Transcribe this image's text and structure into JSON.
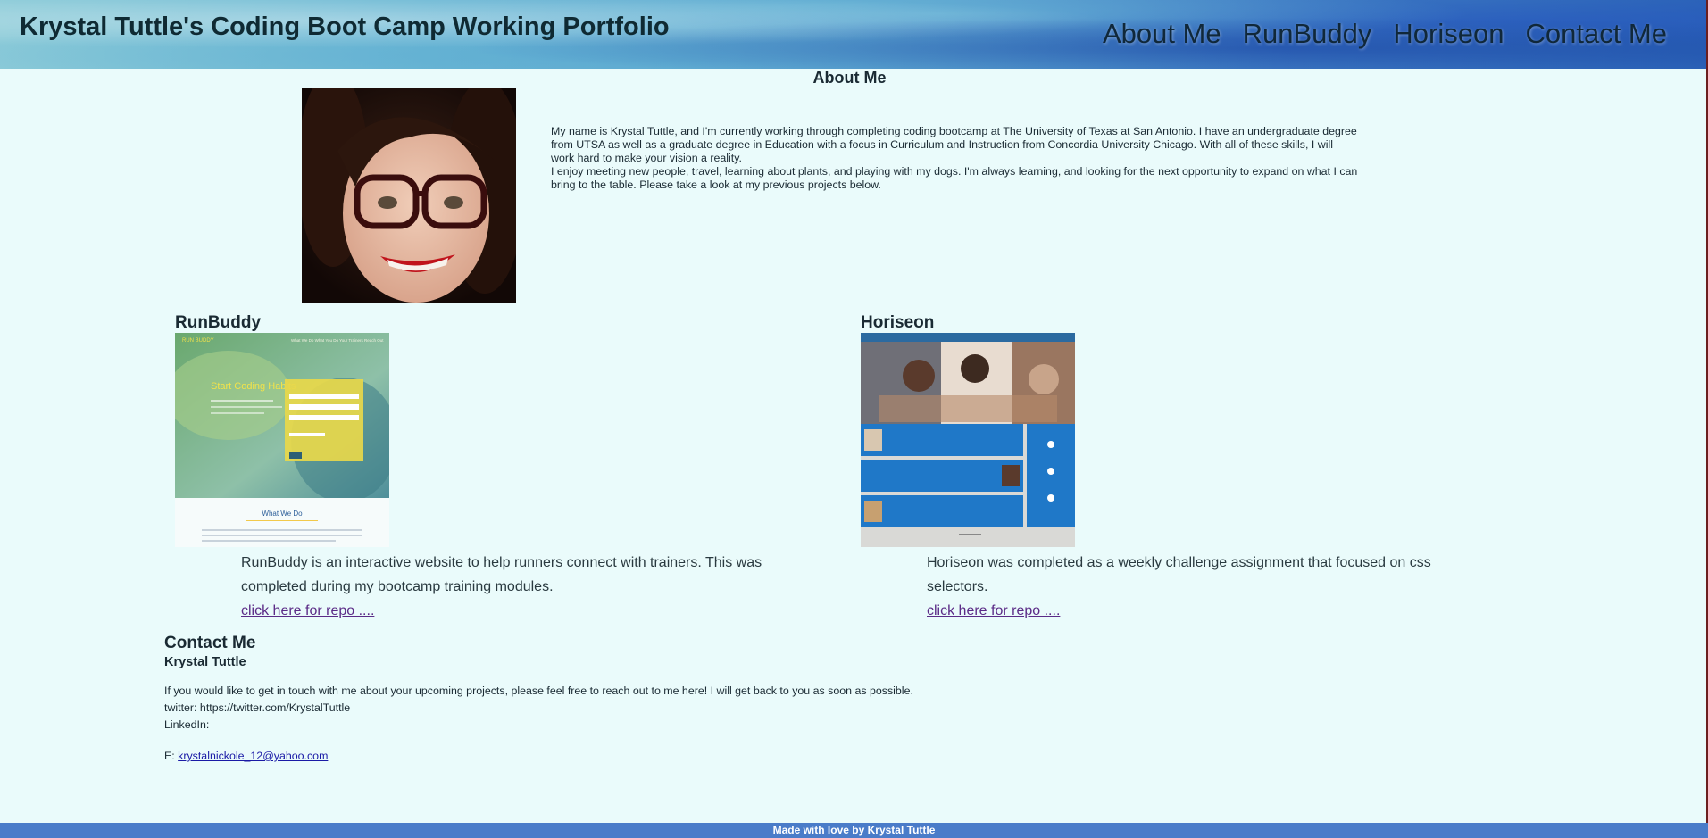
{
  "header": {
    "title": "Krystal Tuttle's Coding Boot Camp Working Portfolio",
    "nav": [
      "About Me",
      "RunBuddy",
      "Horiseon",
      "Contact Me"
    ]
  },
  "about": {
    "heading": "About Me",
    "paragraph1": "My name is Krystal Tuttle, and I'm currently working through completing coding bootcamp at The University of Texas at San Antonio. I have an undergraduate degree from UTSA as well as a graduate degree in Education with a focus in Curriculum and Instruction from Concordia University Chicago. With all of these skills, I will work hard to make your vision a reality.",
    "paragraph2": "I enjoy meeting new people, travel, learning about plants, and playing with my dogs. I'm always learning, and looking for the next opportunity to expand on what I can bring to the table. Please take a look at my previous projects below."
  },
  "projects": [
    {
      "name": "RunBuddy",
      "description": "RunBuddy is an interactive website to help runners connect with trainers. This was completed during my bootcamp training modules.",
      "link": "click here for repo ....",
      "thumb_banner": "Start Coding Habits",
      "thumb_section": "What We Do"
    },
    {
      "name": "Horiseon",
      "description": "Horiseon was completed as a weekly challenge assignment that focused on css selectors.",
      "link": "click here for repo ...."
    }
  ],
  "contact": {
    "heading": "Contact Me",
    "name": "Krystal Tuttle",
    "intro": "If you would like to get in touch with me about your upcoming projects, please feel free to reach out to me here! I will get back to you as soon as possible.",
    "twitter": "twitter: https://twitter.com/KrystalTuttle",
    "linkedin": "LinkedIn:",
    "email_prefix": "E: ",
    "email": "krystalnickole_12@yahoo.com"
  },
  "footer": {
    "text": "Made with love by Krystal Tuttle"
  }
}
